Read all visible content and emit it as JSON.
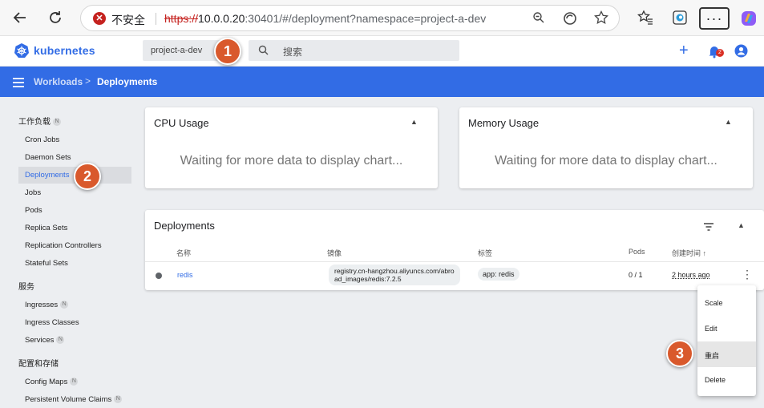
{
  "browser": {
    "insecure_label": "不安全",
    "url_scheme": "https://",
    "url_host": "10.0.0.20",
    "url_rest": ":30401/#/deployment?namespace=project-a-dev",
    "more_label": "···",
    "notif_count": "2"
  },
  "app": {
    "brand": "kubernetes",
    "namespace": "project-a-dev",
    "search_placeholder": "搜索"
  },
  "breadcrumb": {
    "parent": "Workloads",
    "separator": ">",
    "current": "Deployments"
  },
  "sidebar": {
    "sections": [
      {
        "title": "工作负载",
        "badge": "N"
      },
      {
        "title": "服务"
      },
      {
        "title": "配置和存储"
      }
    ],
    "items": [
      {
        "label": "Cron Jobs"
      },
      {
        "label": "Daemon Sets"
      },
      {
        "label": "Deployments"
      },
      {
        "label": "Jobs"
      },
      {
        "label": "Pods"
      },
      {
        "label": "Replica Sets"
      },
      {
        "label": "Replication Controllers"
      },
      {
        "label": "Stateful Sets"
      },
      {
        "label": "Ingresses",
        "badge": "N"
      },
      {
        "label": "Ingress Classes"
      },
      {
        "label": "Services",
        "badge": "N"
      },
      {
        "label": "Config Maps",
        "badge": "N"
      },
      {
        "label": "Persistent Volume Claims",
        "badge": "N"
      }
    ]
  },
  "cpu_card": {
    "title": "CPU Usage",
    "message": "Waiting for more data to display chart..."
  },
  "memory_card": {
    "title": "Memory Usage",
    "message": "Waiting for more data to display chart..."
  },
  "deployments": {
    "title": "Deployments",
    "columns": [
      "名称",
      "镜像",
      "标签",
      "Pods",
      "创建时间 ↑"
    ],
    "rows": [
      {
        "name": "redis",
        "image_line1": "registry.cn-hangzhou.aliyuncs.com/abro",
        "image_line2": "ad_images/redis:7.2.5",
        "label": "app: redis",
        "pods": "0 / 1",
        "created": "2 hours ago"
      }
    ]
  },
  "context_menu": {
    "items": [
      "Scale",
      "Edit",
      "重启",
      "Delete"
    ]
  },
  "callouts": [
    "1",
    "2",
    "3"
  ],
  "colors": {
    "brand_blue": "#326ce5",
    "callout_orange": "#d9592c",
    "insecure_red": "#c5221f"
  }
}
